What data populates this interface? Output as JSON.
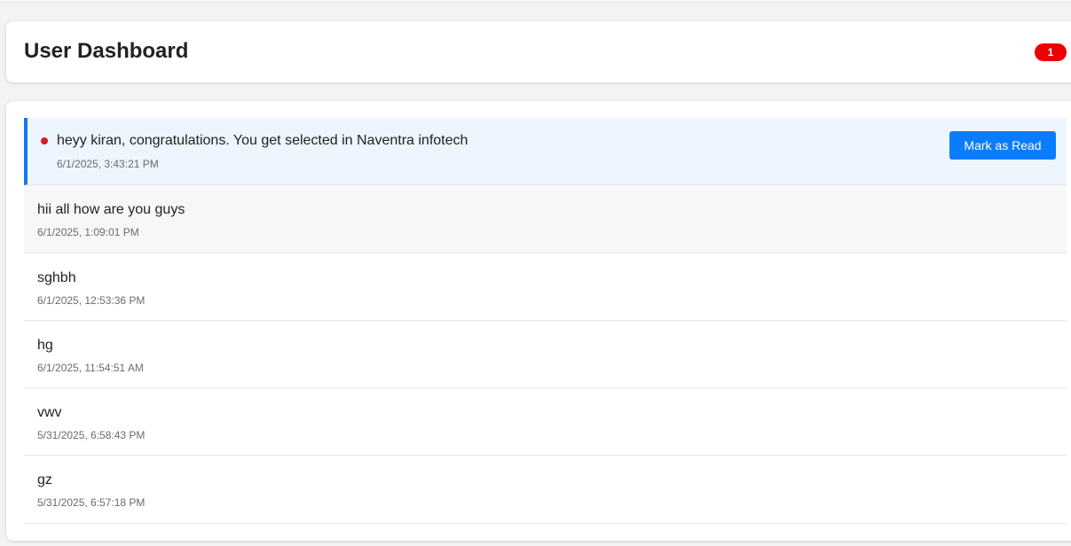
{
  "header": {
    "title": "User Dashboard",
    "unread_count": "1"
  },
  "notifications": [
    {
      "message": "heyy kiran, congratulations. You get selected in Naventra infotech",
      "time": "6/1/2025, 3:43:21 PM",
      "unread": true,
      "action_label": "Mark as Read"
    },
    {
      "message": "hii all how are you guys",
      "time": "6/1/2025, 1:09:01 PM",
      "unread": false
    },
    {
      "message": "sghbh",
      "time": "6/1/2025, 12:53:36 PM",
      "unread": false
    },
    {
      "message": "hg",
      "time": "6/1/2025, 11:54:51 AM",
      "unread": false
    },
    {
      "message": "vwv",
      "time": "5/31/2025, 6:58:43 PM",
      "unread": false
    },
    {
      "message": "gz",
      "time": "5/31/2025, 6:57:18 PM",
      "unread": false
    }
  ],
  "colors": {
    "accent": "#0a7cff",
    "unread_background": "#edf6ff",
    "badge": "#ee0000",
    "unread_dot": "#d81b2b"
  }
}
